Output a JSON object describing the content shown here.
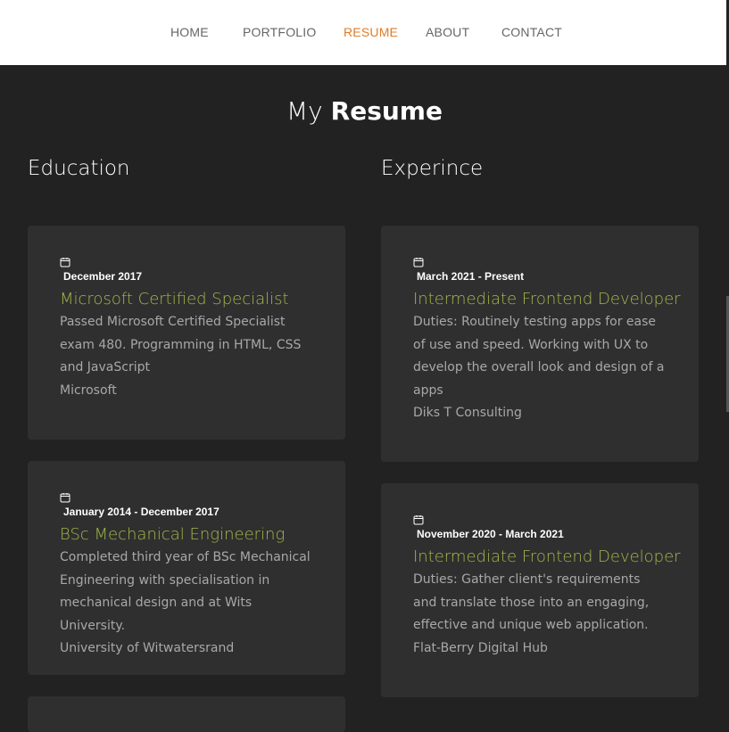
{
  "nav": {
    "items": [
      {
        "label": "HOME"
      },
      {
        "label": "PORTFOLIO"
      },
      {
        "label": "RESUME"
      },
      {
        "label": "ABOUT"
      },
      {
        "label": "CONTACT"
      }
    ],
    "active": "RESUME"
  },
  "page_title": {
    "prefix": "My",
    "emphasis": "Resume"
  },
  "education": {
    "heading": "Education",
    "items": [
      {
        "date": "December 2017",
        "title": "Microsoft Certified Specialist",
        "description": "Passed Microsoft Certified Specialist exam 480. Programming in HTML, CSS and JavaScript",
        "organization": "Microsoft"
      },
      {
        "date": "January 2014 - December 2017",
        "title": "BSc Mechanical Engineering",
        "description": "Completed third year of BSc Mechanical Engineering with specialisation in mechanical design and at Wits University.",
        "organization": "University of Witwatersrand"
      }
    ]
  },
  "experience": {
    "heading": "Experince",
    "items": [
      {
        "date": "March 2021 - Present",
        "title": "Intermediate Frontend Developer",
        "description": "Duties: Routinely testing apps for ease of use and speed. Working with UX to develop the overall look and design of a apps",
        "organization": "Diks T Consulting"
      },
      {
        "date": "November 2020 - March 2021",
        "title": "Intermediate Frontend Developer",
        "description": "Duties: Gather client's requirements and translate those into an engaging, effective and unique web application.",
        "organization": "Flat-Berry Digital Hub"
      }
    ]
  },
  "colors": {
    "background": "#222222",
    "card": "#2f2f2f",
    "accent": "#e07b27",
    "title_green": "#a2b84a"
  },
  "icons": {
    "date": "calendar-icon"
  }
}
